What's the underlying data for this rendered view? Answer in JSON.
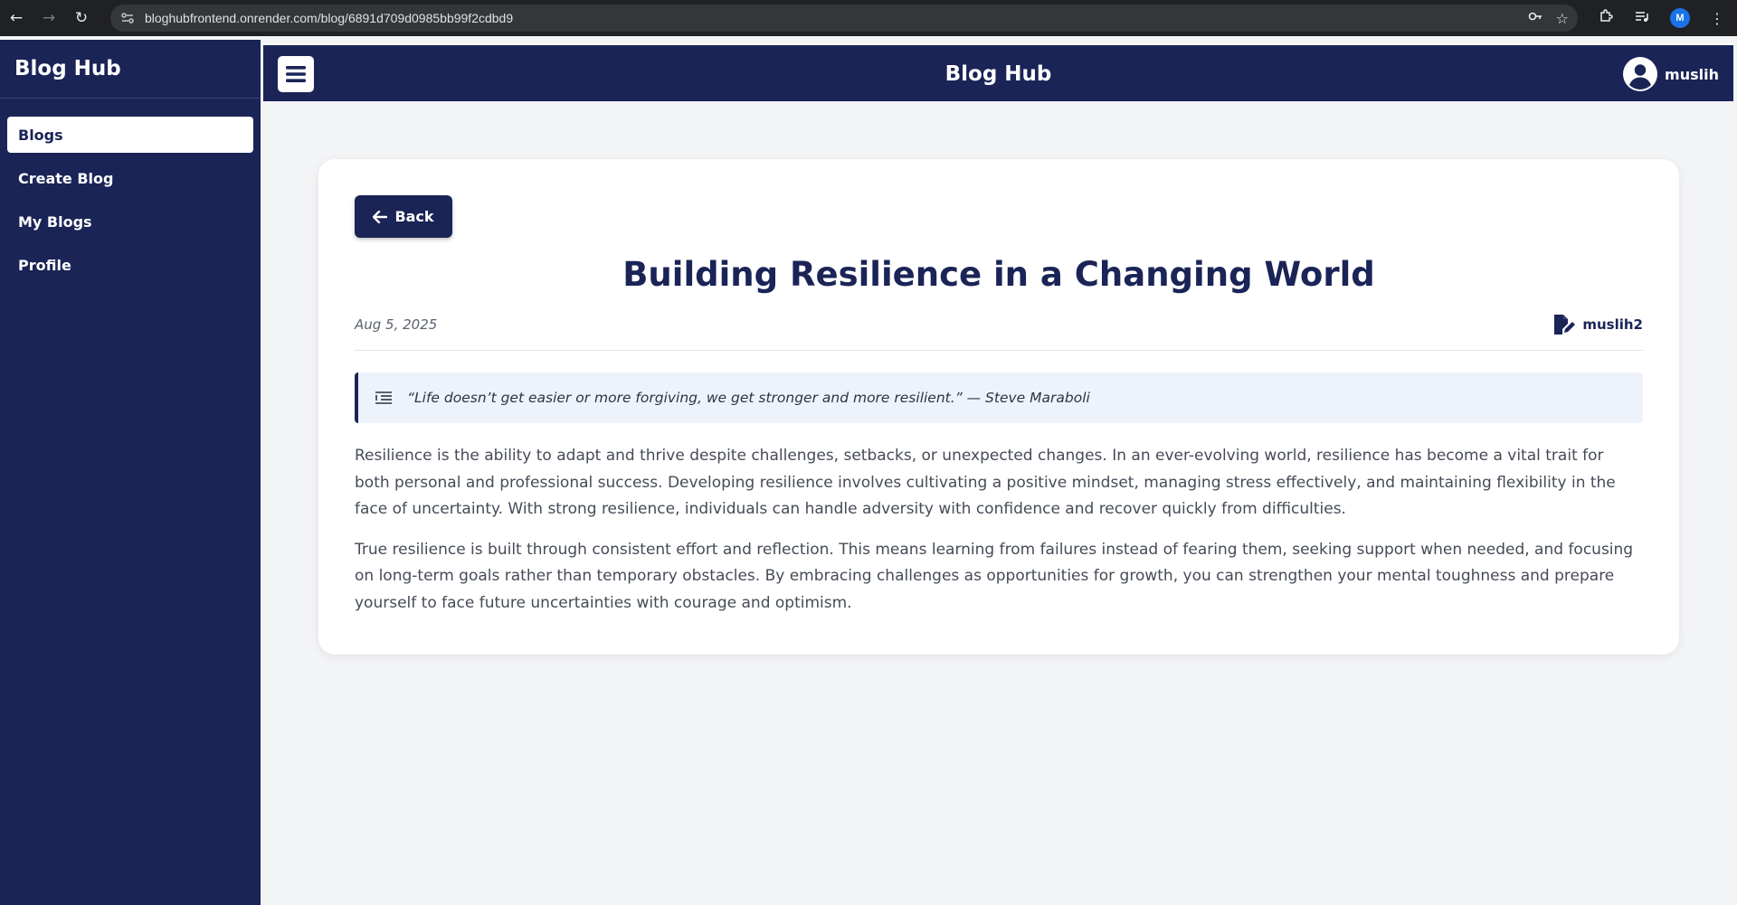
{
  "browser": {
    "url": "bloghubfrontend.onrender.com/blog/6891d709d0985bb99f2cdbd9",
    "profile_initial": "M"
  },
  "sidebar": {
    "brand": "Blog Hub",
    "items": [
      {
        "label": "Blogs",
        "active": true
      },
      {
        "label": "Create Blog",
        "active": false
      },
      {
        "label": "My Blogs",
        "active": false
      },
      {
        "label": "Profile",
        "active": false
      }
    ]
  },
  "header": {
    "title": "Blog Hub",
    "username": "muslih"
  },
  "post": {
    "back_label": "Back",
    "title": "Building Resilience in a Changing World",
    "date": "Aug 5, 2025",
    "author": "muslih2",
    "quote": "“Life doesn’t get easier or more forgiving, we get stronger and more resilient.” — Steve Maraboli",
    "paragraphs": [
      "Resilience is the ability to adapt and thrive despite challenges, setbacks, or unexpected changes. In an ever-evolving world, resilience has become a vital trait for both personal and professional success. Developing resilience involves cultivating a positive mindset, managing stress effectively, and maintaining flexibility in the face of uncertainty. With strong resilience, individuals can handle adversity with confidence and recover quickly from difficulties.",
      "True resilience is built through consistent effort and reflection. This means learning from failures instead of fearing them, seeking support when needed, and focusing on long-term goals rather than temporary obstacles. By embracing challenges as opportunities for growth, you can strengthen your mental toughness and prepare yourself to face future uncertainties with courage and optimism."
    ]
  },
  "colors": {
    "navy": "#1a2456",
    "page_bg": "#f3f4f6",
    "quote_bg": "#eef3fb"
  }
}
